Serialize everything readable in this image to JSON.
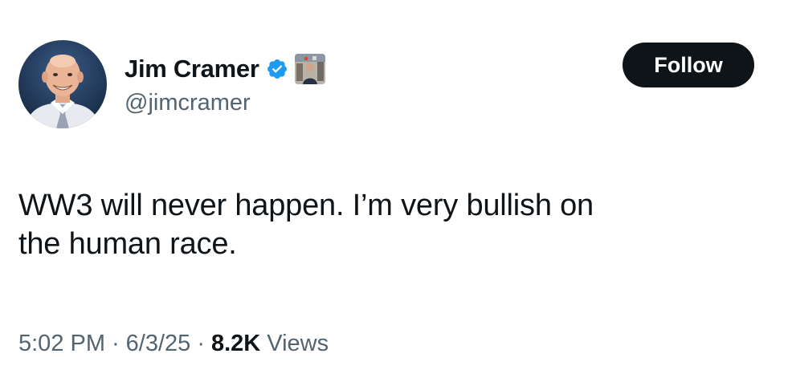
{
  "author": {
    "display_name": "Jim Cramer",
    "handle": "@jimcramer",
    "avatar_icon": "profile-photo",
    "verified_icon": "verified-check-icon",
    "verified_color": "#1d9bf0",
    "affiliate_icon": "affiliate-badge-image"
  },
  "follow_button": {
    "label": "Follow",
    "background": "#0f1419",
    "text_color": "#ffffff"
  },
  "tweet": {
    "text_lines": [
      "WW3 will never happen. I’m very bullish on",
      "the human race."
    ]
  },
  "meta": {
    "time": "5:02 PM",
    "separator": "·",
    "date": "6/3/25",
    "views_count": "8.2K",
    "views_label": "Views"
  }
}
